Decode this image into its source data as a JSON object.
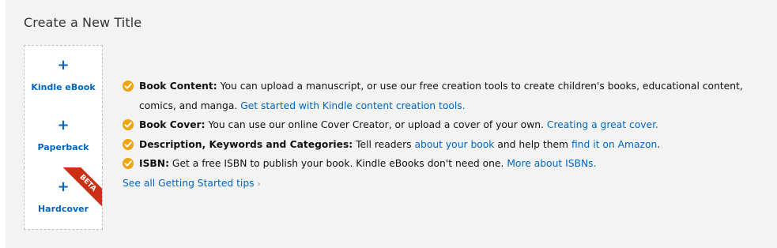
{
  "header": {
    "title": "Create a New Title"
  },
  "tiles": [
    {
      "icon": "+",
      "label": "Kindle eBook"
    },
    {
      "icon": "+",
      "label": "Paperback"
    },
    {
      "icon": "+",
      "label": "Hardcover",
      "badge": "BETA"
    }
  ],
  "tips": [
    {
      "bold": "Book Content:",
      "text": " You can upload a manuscript, or use our free creation tools to create children's books, educational content, comics, and manga. ",
      "link": "Get started with Kindle content creation tools."
    },
    {
      "bold": "Book Cover:",
      "text": " You can use our online Cover Creator, or upload a cover of your own. ",
      "link": "Creating a great cover."
    },
    {
      "bold": "Description, Keywords and Categories:",
      "text1": " Tell readers ",
      "link1": "about your book",
      "text2": " and help them ",
      "link2": "find it on Amazon",
      "text3": "."
    },
    {
      "bold": "ISBN:",
      "text": " Get a free ISBN to publish your book. Kindle eBooks don't need one. ",
      "link": "More about ISBNs."
    }
  ],
  "see_all": {
    "label": "See all Getting Started tips",
    "chevron": "›"
  },
  "colors": {
    "accent": "#0066c0",
    "check": "#f0a30a",
    "ribbon": "#cc2f14",
    "panel": "#f3f3f3"
  },
  "icons": {
    "tip_bullet": "check-circle-icon"
  }
}
